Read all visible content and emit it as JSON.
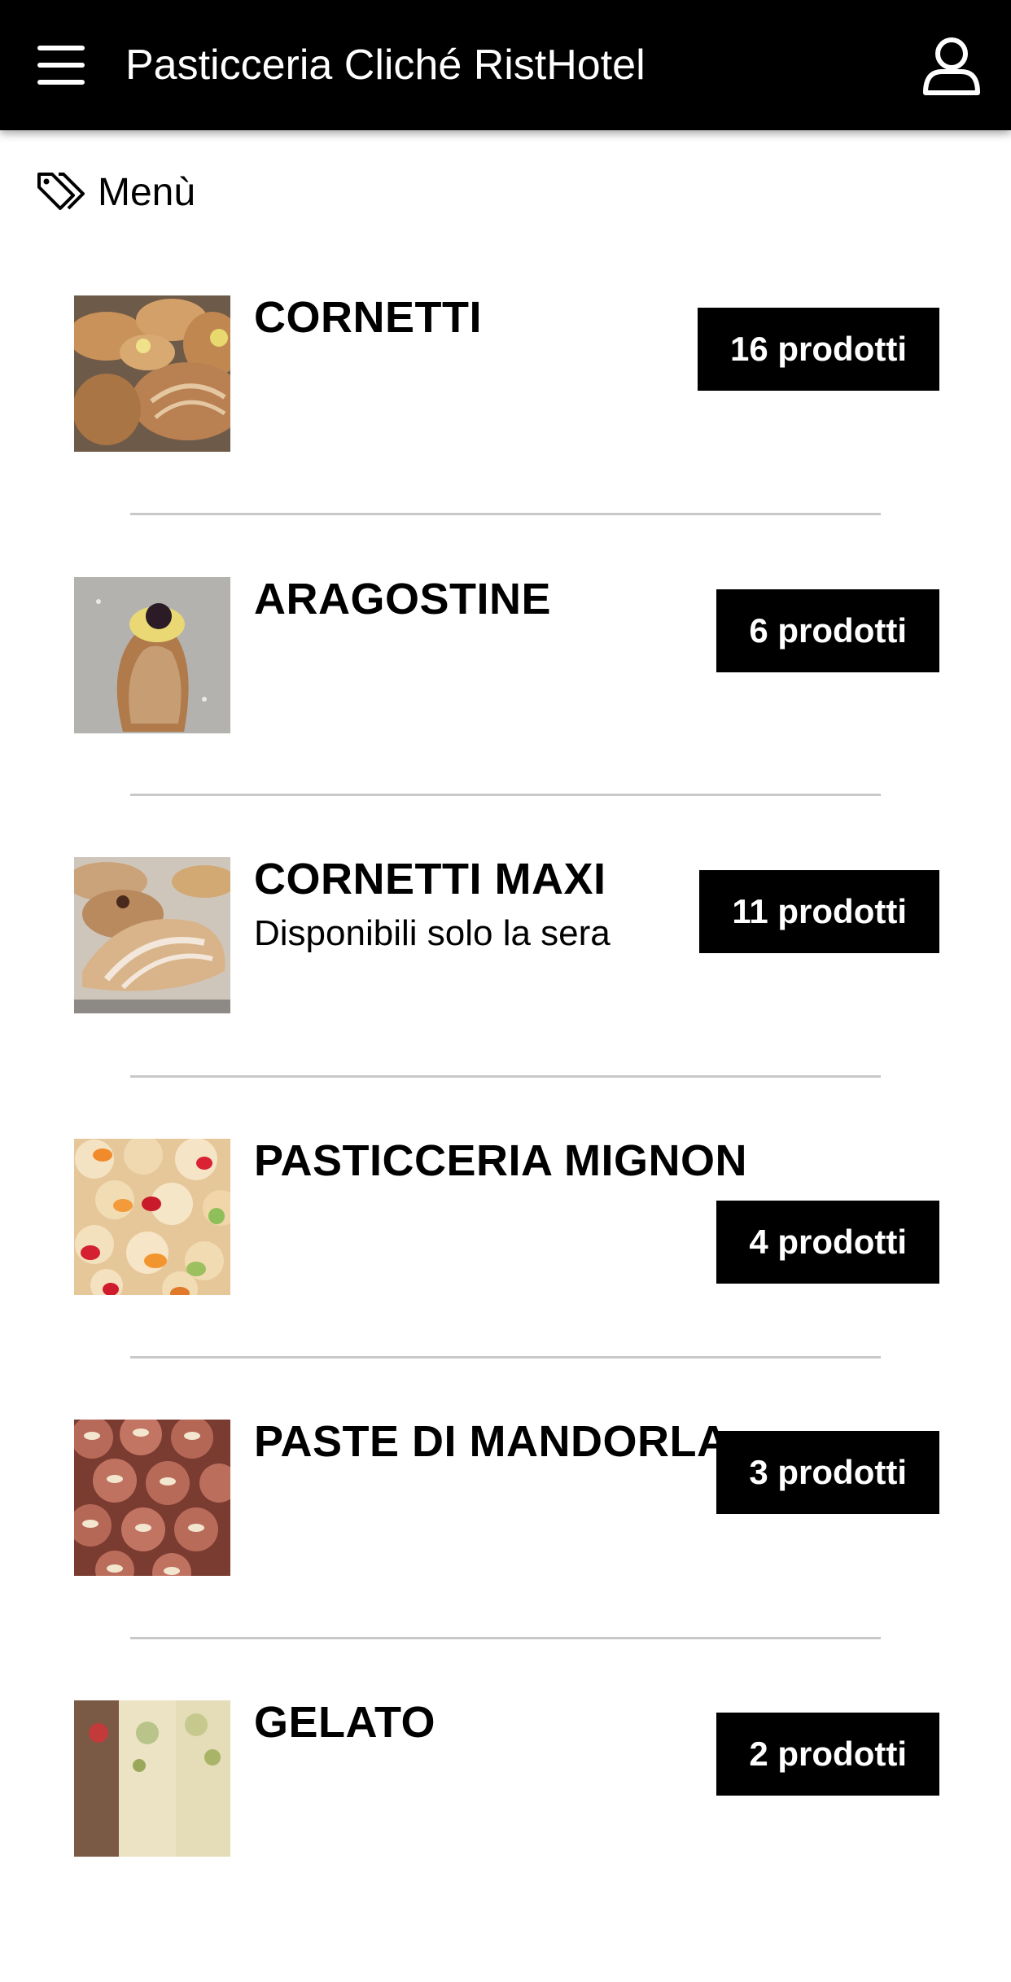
{
  "header": {
    "title": "Pasticceria Cliché RistHotel",
    "menu_icon": "hamburger-menu-icon",
    "user_icon": "user-icon",
    "background": "#000000",
    "text_color": "#ffffff"
  },
  "section": {
    "icon": "tag-icon",
    "label": "Menù"
  },
  "categories": [
    {
      "name": "CORNETTI",
      "description": "",
      "count_label": "16 prodotti",
      "image": "cornetti-photo"
    },
    {
      "name": "ARAGOSTINE",
      "description": "",
      "count_label": "6 prodotti",
      "image": "aragostine-photo"
    },
    {
      "name": "CORNETTI MAXI",
      "description": "Disponibili solo la sera",
      "count_label": "11 prodotti",
      "image": "cornetti-maxi-photo"
    },
    {
      "name": "PASTICCERIA MIGNON",
      "description": "",
      "count_label": "4 prodotti",
      "image": "pasticceria-mignon-photo"
    },
    {
      "name": "PASTE DI MANDORLA",
      "description": "",
      "count_label": "3 prodotti",
      "image": "paste-di-mandorla-photo"
    },
    {
      "name": "GELATO",
      "description": "",
      "count_label": "2 prodotti",
      "image": "gelato-photo"
    }
  ]
}
